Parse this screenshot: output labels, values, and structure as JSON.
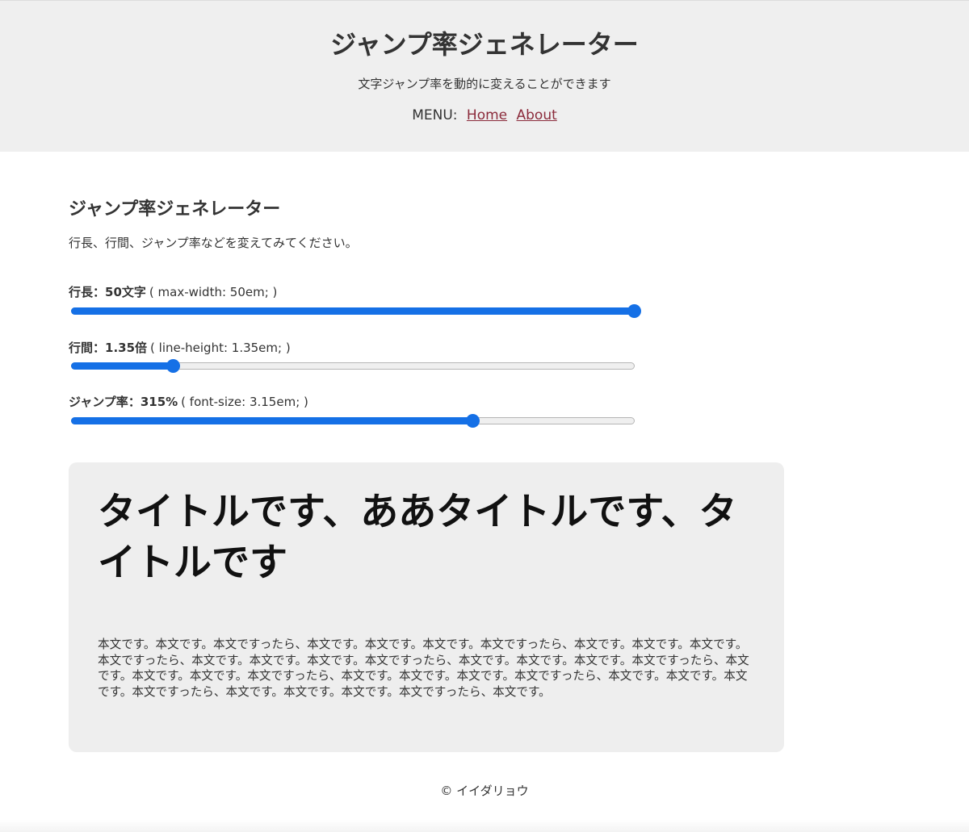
{
  "header": {
    "title": "ジャンプ率ジェネレーター",
    "tagline": "文字ジャンプ率を動的に変えることができます",
    "menu_label": "MENU:",
    "nav": [
      {
        "label": "Home"
      },
      {
        "label": "About"
      }
    ],
    "link_color": "#8b2b3b"
  },
  "main": {
    "heading": "ジャンプ率ジェネレーター",
    "intro": "行長、行間、ジャンプ率などを変えてみてください。"
  },
  "controls": [
    {
      "name": "行長",
      "value_text": "50文字",
      "css_hint": "( max-width: 50em; )",
      "value": 50,
      "min": 0,
      "max": 50,
      "fraction": 1.0
    },
    {
      "name": "行間",
      "value_text": "1.35倍",
      "css_hint": "( line-height: 1.35em; )",
      "value": 1.35,
      "fraction": 0.18
    },
    {
      "name": "ジャンプ率",
      "value_text": "315%",
      "css_hint": "( font-size: 3.15em; )",
      "value": 315,
      "fraction": 0.712
    }
  ],
  "controls_sep": "：",
  "accent_color": "#1570e6",
  "preview": {
    "title": "タイトルです、ああタイトルです、タイトルです",
    "body": "本文です。本文です。本文ですったら、本文です。本文です。本文です。本文ですったら、本文です。本文です。本文です。本文ですったら、本文です。本文です。本文です。本文ですったら、本文です。本文です。本文です。本文ですったら、本文です。本文です。本文です。本文ですったら、本文です。本文です。本文です。本文ですったら、本文です。本文です。本文です。本文ですったら、本文です。本文です。本文です。本文ですったら、本文です。"
  },
  "footer": {
    "copyright": "© イイダリョウ"
  }
}
